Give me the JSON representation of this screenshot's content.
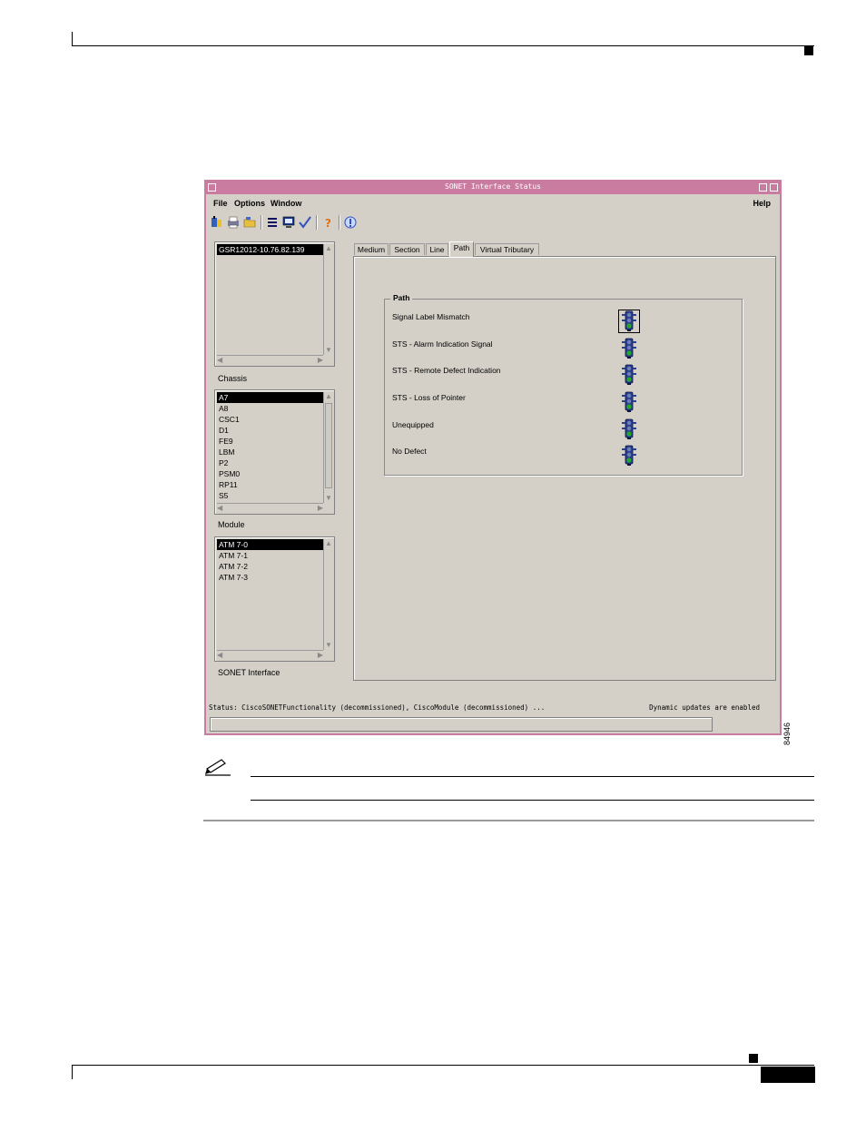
{
  "window": {
    "title": "SONET Interface Status",
    "accent_color": "#c97ca0"
  },
  "menu": {
    "file": "File",
    "options": "Options",
    "window": "Window",
    "help": "Help"
  },
  "toolbar": {
    "icons": [
      "open-icon",
      "print-icon",
      "folder-icon",
      "list-icon",
      "monitor-icon",
      "check-icon",
      "help-icon",
      "info-icon"
    ]
  },
  "device_list": {
    "items": [
      "GSR12012-10.76.82.139"
    ],
    "selected": 0
  },
  "chassis": {
    "label": "Chassis",
    "items": [
      "A7",
      "A8",
      "CSC1",
      "D1",
      "FE9",
      "LBM",
      "P2",
      "PSM0",
      "RP11",
      "S5"
    ],
    "selected": 0
  },
  "module": {
    "label": "Module",
    "items": [
      "ATM 7-0",
      "ATM 7-1",
      "ATM 7-2",
      "ATM 7-3"
    ],
    "selected": 0
  },
  "sonet_interface": {
    "label": "SONET Interface"
  },
  "tabs": [
    "Medium",
    "Section",
    "Line",
    "Path",
    "Virtual Tributary"
  ],
  "active_tab": 3,
  "path_group": {
    "title": "Path",
    "alarms": [
      "Signal Label Mismatch",
      "STS - Alarm Indication Signal",
      "STS - Remote Defect Indication",
      "STS - Loss of Pointer",
      "Unequipped",
      "No Defect"
    ],
    "light_color": "#22aa22"
  },
  "status": {
    "text": "Status: CiscoSONETFunctionality (decommissioned), CiscoModule (decommissioned) ...",
    "updates": "Dynamic updates are enabled"
  },
  "figure_id": "84946"
}
